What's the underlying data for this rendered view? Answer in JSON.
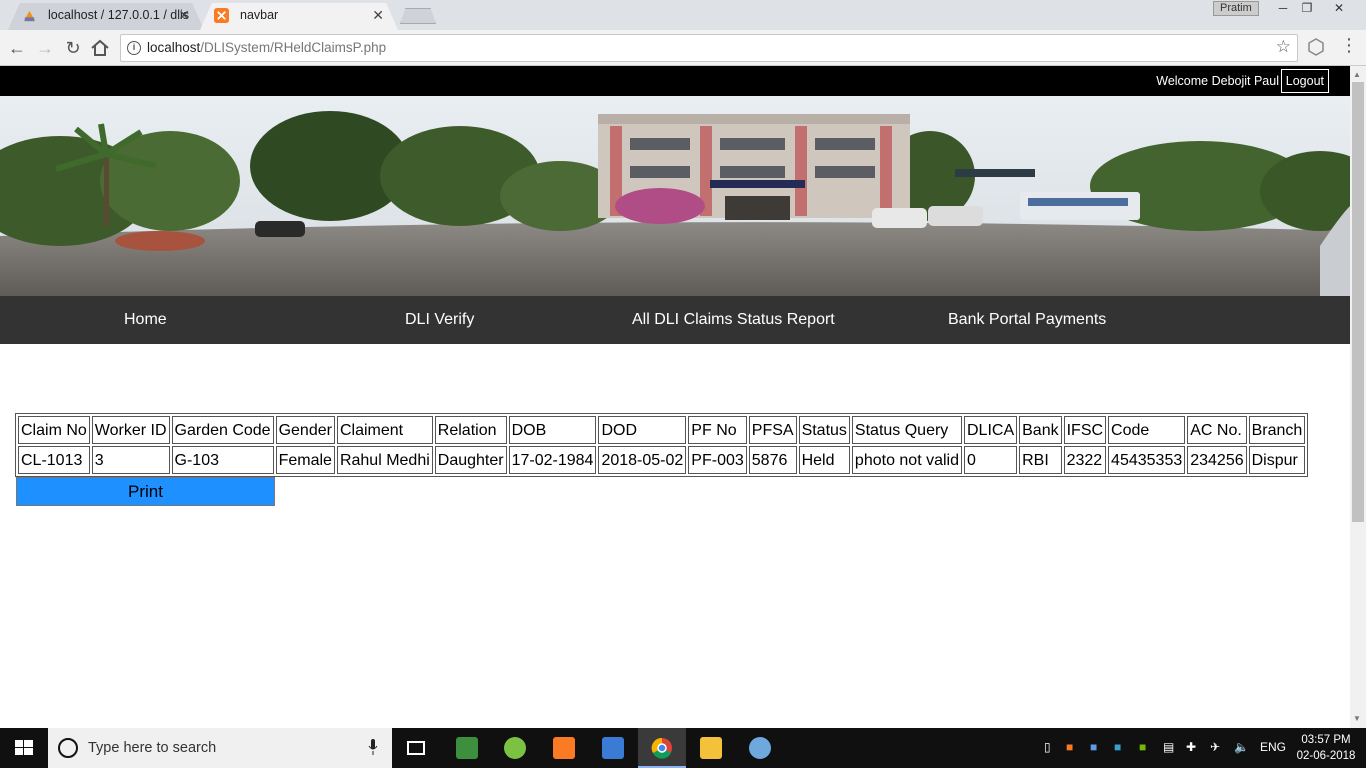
{
  "browser": {
    "tabs": [
      {
        "title": "localhost / 127.0.0.1 / dlis",
        "active": false
      },
      {
        "title": "navbar",
        "active": true
      }
    ],
    "profile_name": "Pratim",
    "url_host": "localhost",
    "url_path": "/DLISystem/RHeldClaimsP.php"
  },
  "header": {
    "welcome_text": "Welcome Debojit Paul",
    "logout_label": "Logout"
  },
  "nav": {
    "items": [
      "Home",
      "DLI Verify",
      "All DLI Claims Status Report",
      "Bank Portal Payments"
    ]
  },
  "claims_table": {
    "columns": [
      "Claim No",
      "Worker ID",
      "Garden Code",
      "Gender",
      "Claiment",
      "Relation",
      "DOB",
      "DOD",
      "PF No",
      "PFSA",
      "Status",
      "Status Query",
      "DLICA",
      "Bank",
      "IFSC",
      "Code",
      "AC No.",
      "Branch"
    ],
    "rows": [
      [
        "CL-1013",
        "3",
        "G-103",
        "Female",
        "Rahul Medhi",
        "Daughter",
        "17-02-1984",
        "2018-05-02",
        "PF-003",
        "5876",
        "Held",
        "photo not valid",
        "0",
        "RBI",
        "2322",
        "45435353",
        "234256",
        "Dispur"
      ]
    ]
  },
  "print_label": "Print",
  "taskbar": {
    "search_placeholder": "Type here to search",
    "language": "ENG",
    "time": "03:57 PM",
    "date": "02-06-2018"
  },
  "colors": {
    "topbar": "#000000",
    "nav_bg": "#333333",
    "print_button": "#1e90ff"
  }
}
